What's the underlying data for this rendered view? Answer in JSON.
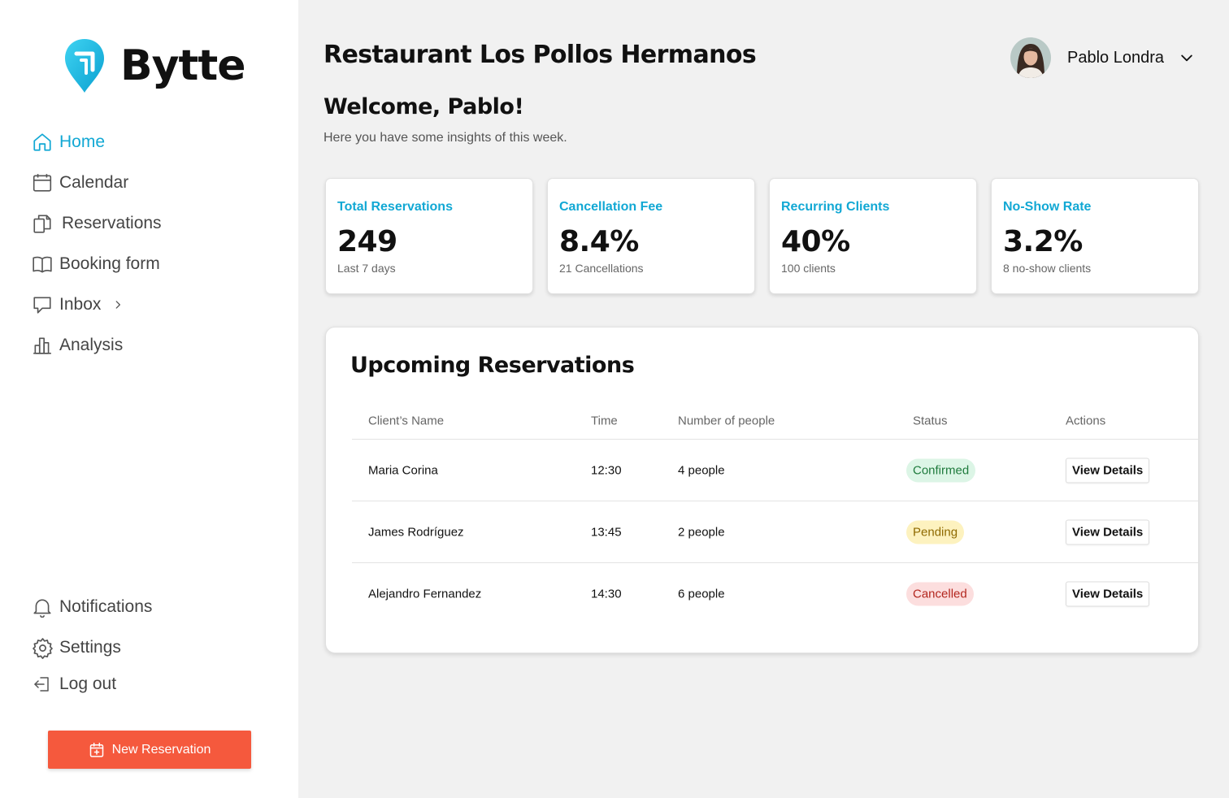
{
  "brand": {
    "name": "Bytte",
    "accent_color": "#12a8d4",
    "cta_color": "#f5593d"
  },
  "sidebar": {
    "items": [
      {
        "label": "Home",
        "icon": "home-icon",
        "active": true
      },
      {
        "label": "Calendar",
        "icon": "calendar-icon"
      },
      {
        "label": "Reservations",
        "icon": "documents-icon"
      },
      {
        "label": "Booking form",
        "icon": "book-icon"
      },
      {
        "label": "Inbox",
        "icon": "chat-icon",
        "has_submenu": true
      },
      {
        "label": "Analysis",
        "icon": "bar-chart-icon"
      }
    ],
    "bottom_items": [
      {
        "label": "Notifications",
        "icon": "bell-icon"
      },
      {
        "label": "Settings",
        "icon": "gear-icon"
      },
      {
        "label": "Log out",
        "icon": "logout-icon"
      }
    ],
    "new_reservation_label": "New Reservation"
  },
  "header": {
    "restaurant_name": "Restaurant Los Pollos Hermanos",
    "user_name": "Pablo Londra"
  },
  "welcome": {
    "title": "Welcome, Pablo!",
    "subtitle": "Here you have some insights of this week."
  },
  "stats": [
    {
      "label": "Total Reservations",
      "value": "249",
      "note": "Last 7 days"
    },
    {
      "label": "Cancellation Fee",
      "value": "8.4%",
      "note": "21 Cancellations"
    },
    {
      "label": "Recurring Clients",
      "value": "40%",
      "note": "100 clients"
    },
    {
      "label": "No-Show Rate",
      "value": "3.2%",
      "note": "8 no-show clients"
    }
  ],
  "reservations": {
    "title": "Upcoming Reservations",
    "columns": [
      "Client’s Name",
      "Time",
      "Number of people",
      "Status",
      "Actions"
    ],
    "rows": [
      {
        "name": "Maria Corina",
        "time": "12:30",
        "people": "4 people",
        "status": "Confirmed",
        "action": "View Details"
      },
      {
        "name": "James Rodríguez",
        "time": "13:45",
        "people": "2 people",
        "status": "Pending",
        "action": "View Details"
      },
      {
        "name": "Alejandro Fernandez",
        "time": "14:30",
        "people": "6 people",
        "status": "Cancelled",
        "action": "View Details"
      }
    ]
  }
}
